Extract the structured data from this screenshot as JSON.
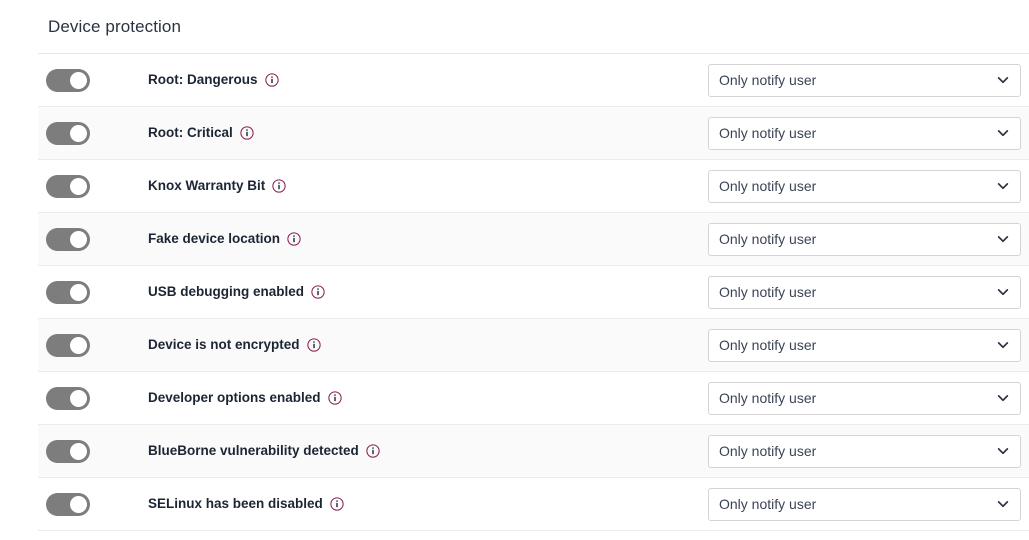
{
  "section": {
    "title": "Device protection"
  },
  "colors": {
    "toggle_on": "#7d7d7d",
    "info_icon": "#8a1c54",
    "label_text": "#1c2533",
    "row_alt_bg": "#fafafa",
    "border": "#ececec"
  },
  "select_options": [
    "Only notify user"
  ],
  "rows": [
    {
      "toggle_state": "on",
      "toggle_name": "toggle-root-dangerous",
      "label": "Root: Dangerous",
      "info_icon": "info-circle-icon",
      "action": "Only notify user"
    },
    {
      "toggle_state": "on",
      "toggle_name": "toggle-root-critical",
      "label": "Root: Critical",
      "info_icon": "info-circle-icon",
      "action": "Only notify user"
    },
    {
      "toggle_state": "on",
      "toggle_name": "toggle-knox-warranty-bit",
      "label": "Knox Warranty Bit",
      "info_icon": "info-circle-icon",
      "action": "Only notify user"
    },
    {
      "toggle_state": "on",
      "toggle_name": "toggle-fake-device-location",
      "label": "Fake device location",
      "info_icon": "info-circle-icon",
      "action": "Only notify user"
    },
    {
      "toggle_state": "on",
      "toggle_name": "toggle-usb-debugging-enabled",
      "label": "USB debugging enabled",
      "info_icon": "info-circle-icon",
      "action": "Only notify user"
    },
    {
      "toggle_state": "on",
      "toggle_name": "toggle-device-is-not-encrypted",
      "label": "Device is not encrypted",
      "info_icon": "info-circle-icon",
      "action": "Only notify user"
    },
    {
      "toggle_state": "on",
      "toggle_name": "toggle-developer-options-enabled",
      "label": "Developer options enabled",
      "info_icon": "info-circle-icon",
      "action": "Only notify user"
    },
    {
      "toggle_state": "on",
      "toggle_name": "toggle-blueborne-vulnerability-detected",
      "label": "BlueBorne vulnerability detected",
      "info_icon": "info-circle-icon",
      "action": "Only notify user"
    },
    {
      "toggle_state": "on",
      "toggle_name": "toggle-selinux-has-been-disabled",
      "label": "SELinux has been disabled",
      "info_icon": "info-circle-icon",
      "action": "Only notify user"
    }
  ]
}
